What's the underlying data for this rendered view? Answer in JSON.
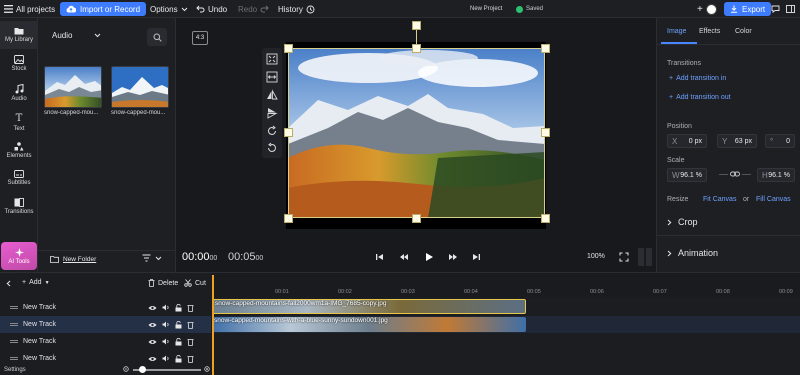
{
  "topbar": {
    "all_projects": "All projects",
    "import_record": "Import or Record",
    "options": "Options",
    "undo": "Undo",
    "redo": "Redo",
    "history": "History",
    "project_name": "New Project",
    "saved": "Saved",
    "export": "Export"
  },
  "rail": {
    "items": [
      {
        "label": "My Library",
        "icon": "folder-icon"
      },
      {
        "label": "Stock",
        "icon": "stock-icon"
      },
      {
        "label": "Audio",
        "icon": "music-note-icon"
      },
      {
        "label": "Text",
        "icon": "text-icon"
      },
      {
        "label": "Elements",
        "icon": "elements-icon"
      },
      {
        "label": "Subtitles",
        "icon": "subtitles-icon"
      },
      {
        "label": "Transitions",
        "icon": "transitions-icon"
      }
    ],
    "ai_tools": "AI Tools"
  },
  "library": {
    "dropdown": "Audio",
    "thumbs": [
      {
        "label": "snow-capped-mou..."
      },
      {
        "label": "snow-capped-mou..."
      }
    ],
    "new_folder": "New Folder"
  },
  "preview": {
    "aspect": "4:3",
    "time_current": "00:00",
    "time_current_frames": "00",
    "time_total": "00:05",
    "time_total_frames": "00",
    "zoom": "100%"
  },
  "props": {
    "tabs": [
      "Image",
      "Effects",
      "Color"
    ],
    "transitions_title": "Transitions",
    "add_transition_in": "Add transition in",
    "add_transition_out": "Add transition out",
    "position_title": "Position",
    "pos_x_key": "X",
    "pos_x": "0 px",
    "pos_y_key": "Y",
    "pos_y": "63 px",
    "rotation": "0",
    "scale_title": "Scale",
    "scale_w_key": "W",
    "scale_w": "96.1 %",
    "scale_h_key": "H",
    "scale_h": "96.1 %",
    "resize_title": "Resize",
    "fit_canvas": "Fit Canvas",
    "or": "or",
    "fill_canvas": "Fill Canvas",
    "crop": "Crop",
    "animation": "Animation"
  },
  "timeline": {
    "add": "Add",
    "delete": "Delete",
    "cut": "Cut",
    "ticks": [
      "00:01",
      "00:02",
      "00:03",
      "00:04",
      "00:05",
      "00:06",
      "00:07",
      "00:08",
      "00:09"
    ],
    "tracks": [
      {
        "name": "New Track"
      },
      {
        "name": "New Track"
      },
      {
        "name": "New Track"
      },
      {
        "name": "New Track"
      }
    ],
    "clips": [
      {
        "label": "snow-capped-mountains-fall2000wm1a-IMG_7685-copy.jpg"
      },
      {
        "label": "snow-capped-mountains-with-a-blue-sunny-sundown001.jpg"
      }
    ],
    "settings": "Settings"
  },
  "colors": {
    "accent": "#3d7bff",
    "ai_tools": "#d655c0",
    "selection_handle": "#fffbe6",
    "saved": "#2fbf71"
  }
}
